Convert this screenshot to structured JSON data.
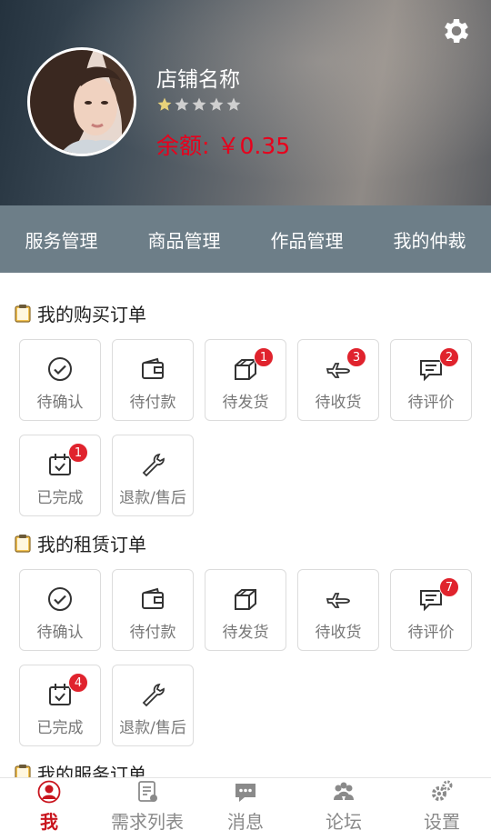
{
  "header": {
    "store_name": "店铺名称",
    "rating": 1,
    "rating_max": 5,
    "balance_label": "余额:",
    "balance_value": "￥0.35",
    "settings_icon": "gear-icon",
    "balance_color": "#e8001c"
  },
  "tabs": [
    {
      "label": "服务管理"
    },
    {
      "label": "商品管理"
    },
    {
      "label": "作品管理"
    },
    {
      "label": "我的仲裁"
    }
  ],
  "sections": [
    {
      "title": "我的购买订单",
      "items": [
        {
          "label": "待确认",
          "icon": "check-circle-icon",
          "badge": ""
        },
        {
          "label": "待付款",
          "icon": "wallet-icon",
          "badge": ""
        },
        {
          "label": "待发货",
          "icon": "box-icon",
          "badge": "1"
        },
        {
          "label": "待收货",
          "icon": "airplane-icon",
          "badge": "3"
        },
        {
          "label": "待评价",
          "icon": "comment-icon",
          "badge": "2"
        },
        {
          "label": "已完成",
          "icon": "calendar-check-icon",
          "badge": "1"
        },
        {
          "label": "退款/售后",
          "icon": "wrench-icon",
          "badge": ""
        }
      ]
    },
    {
      "title": "我的租赁订单",
      "items": [
        {
          "label": "待确认",
          "icon": "check-circle-icon",
          "badge": ""
        },
        {
          "label": "待付款",
          "icon": "wallet-icon",
          "badge": ""
        },
        {
          "label": "待发货",
          "icon": "box-icon",
          "badge": ""
        },
        {
          "label": "待收货",
          "icon": "airplane-icon",
          "badge": ""
        },
        {
          "label": "待评价",
          "icon": "comment-icon",
          "badge": "7"
        },
        {
          "label": "已完成",
          "icon": "calendar-check-icon",
          "badge": "4"
        },
        {
          "label": "退款/售后",
          "icon": "wrench-icon",
          "badge": ""
        }
      ]
    },
    {
      "title": "我的服务订单",
      "items": []
    }
  ],
  "bottom_nav": [
    {
      "label": "我",
      "icon": "user-icon",
      "active": true
    },
    {
      "label": "需求列表",
      "icon": "list-icon",
      "active": false
    },
    {
      "label": "消息",
      "icon": "message-icon",
      "active": false
    },
    {
      "label": "论坛",
      "icon": "community-icon",
      "active": false
    },
    {
      "label": "设置",
      "icon": "gears-icon",
      "active": false
    }
  ],
  "colors": {
    "accent_red": "#c9151e",
    "badge_red": "#e0232d",
    "tab_bar": "#6d7e88",
    "star_filled": "#e8d27a",
    "star_empty": "#cfcfcf"
  }
}
